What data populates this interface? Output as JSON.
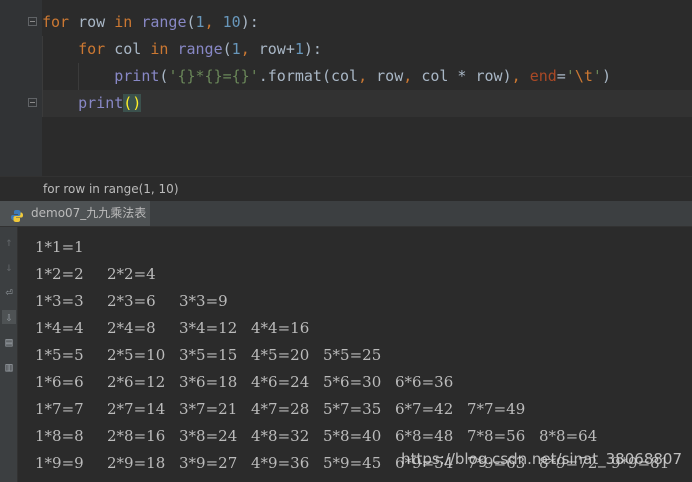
{
  "editor": {
    "lines": [
      {
        "tokens": [
          {
            "t": "for ",
            "c": "kw"
          },
          {
            "t": "row ",
            "c": ""
          },
          {
            "t": "in ",
            "c": "kw"
          },
          {
            "t": "range",
            "c": "fn"
          },
          {
            "t": "(",
            "c": ""
          },
          {
            "t": "1",
            "c": "num"
          },
          {
            "t": ", ",
            "c": "kw"
          },
          {
            "t": "10",
            "c": "num"
          },
          {
            "t": "):",
            "c": ""
          }
        ]
      },
      {
        "tokens": [
          {
            "t": "    for ",
            "c": "kw"
          },
          {
            "t": "col ",
            "c": ""
          },
          {
            "t": "in ",
            "c": "kw"
          },
          {
            "t": "range",
            "c": "fn"
          },
          {
            "t": "(",
            "c": ""
          },
          {
            "t": "1",
            "c": "num"
          },
          {
            "t": ", ",
            "c": "kw"
          },
          {
            "t": "row+",
            "c": ""
          },
          {
            "t": "1",
            "c": "num"
          },
          {
            "t": "):",
            "c": ""
          }
        ]
      },
      {
        "tokens": [
          {
            "t": "        print",
            "c": "fn"
          },
          {
            "t": "(",
            "c": ""
          },
          {
            "t": "'{}*{}={}'",
            "c": "str"
          },
          {
            "t": ".format(col",
            "c": ""
          },
          {
            "t": ", ",
            "c": "kw"
          },
          {
            "t": "row",
            "c": ""
          },
          {
            "t": ", ",
            "c": "kw"
          },
          {
            "t": "col * row)",
            "c": ""
          },
          {
            "t": ", ",
            "c": "kw"
          },
          {
            "t": "end",
            "c": "param"
          },
          {
            "t": "=",
            "c": ""
          },
          {
            "t": "'",
            "c": "str"
          },
          {
            "t": "\\t",
            "c": "esc"
          },
          {
            "t": "'",
            "c": "str"
          },
          {
            "t": ")",
            "c": ""
          }
        ]
      },
      {
        "tokens": [
          {
            "t": "    print",
            "c": "fn"
          },
          {
            "t": "()",
            "c": "paren-hl"
          }
        ]
      }
    ]
  },
  "breadcrumb": {
    "text": "for row in range(1, 10)"
  },
  "run_tab": {
    "label": "demo07_九九乘法表",
    "icon": "python-icon"
  },
  "console": {
    "side_buttons": [
      "up-arrow-icon",
      "down-arrow-icon",
      "soft-wrap-icon",
      "scroll-to-end-icon",
      "print-icon",
      "trash-icon"
    ],
    "rows": [
      [
        "1*1=1"
      ],
      [
        "1*2=2",
        "2*2=4"
      ],
      [
        "1*3=3",
        "2*3=6",
        "3*3=9"
      ],
      [
        "1*4=4",
        "2*4=8",
        "3*4=12",
        "4*4=16"
      ],
      [
        "1*5=5",
        "2*5=10",
        "3*5=15",
        "4*5=20",
        "5*5=25"
      ],
      [
        "1*6=6",
        "2*6=12",
        "3*6=18",
        "4*6=24",
        "5*6=30",
        "6*6=36"
      ],
      [
        "1*7=7",
        "2*7=14",
        "3*7=21",
        "4*7=28",
        "5*7=35",
        "6*7=42",
        "7*7=49"
      ],
      [
        "1*8=8",
        "2*8=16",
        "3*8=24",
        "4*8=32",
        "5*8=40",
        "6*8=48",
        "7*8=56",
        "8*8=64"
      ],
      [
        "1*9=9",
        "2*9=18",
        "3*9=27",
        "4*9=36",
        "5*9=45",
        "6*9=54",
        "7*9=63",
        "8*9=72",
        "9*9=81"
      ]
    ]
  },
  "watermark": "https://blog.csdn.net/sinat_38068807",
  "colors": {
    "background": "#2b2b2b",
    "keyword": "#cc7832",
    "builtin": "#8888c6",
    "number": "#6897bb",
    "string": "#6a8759",
    "text": "#a9b7c6"
  }
}
